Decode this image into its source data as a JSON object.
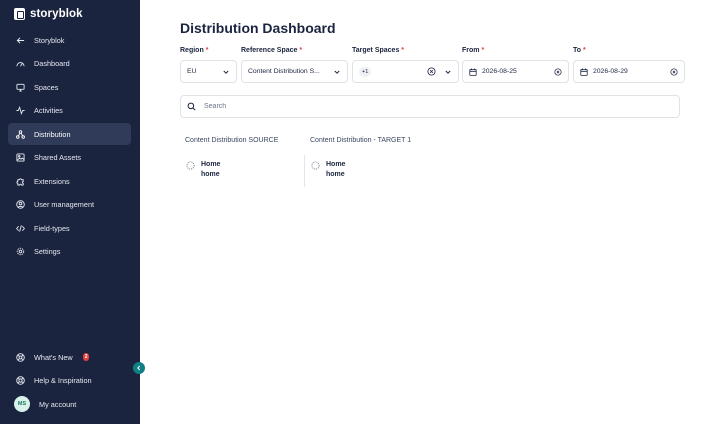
{
  "sidebar": {
    "brand": "storyblok",
    "items": [
      {
        "label": "Storyblok",
        "icon": "arrow-left-icon"
      },
      {
        "label": "Dashboard",
        "icon": "gauge-icon"
      },
      {
        "label": "Spaces",
        "icon": "monitor-icon"
      },
      {
        "label": "Activities",
        "icon": "activity-icon"
      },
      {
        "label": "Distribution",
        "icon": "distribution-icon",
        "active": true
      },
      {
        "label": "Shared Assets",
        "icon": "image-icon"
      },
      {
        "label": "Extensions",
        "icon": "puzzle-icon"
      },
      {
        "label": "User management",
        "icon": "user-circle-icon"
      },
      {
        "label": "Field-types",
        "icon": "code-icon"
      },
      {
        "label": "Settings",
        "icon": "gear-icon"
      }
    ],
    "bottom": {
      "whats_new": "What's New",
      "whats_new_badge": "2",
      "help": "Help & Inspiration",
      "account": "My account",
      "avatar_initials": "MS"
    }
  },
  "page": {
    "title": "Distribution Dashboard",
    "filters": {
      "region": {
        "label": "Region",
        "value": "EU"
      },
      "reference_space": {
        "label": "Reference Space",
        "value": "Content Distribution S..."
      },
      "target_spaces": {
        "label": "Target Spaces",
        "chip": "+1"
      },
      "from": {
        "label": "From",
        "value": "2026-08-25"
      },
      "to": {
        "label": "To",
        "value": "2026-08-29"
      },
      "required_marker": "*"
    },
    "search_placeholder": "Search",
    "columns": [
      {
        "title": "Content Distribution SOURCE",
        "item_name": "Home",
        "item_slug": "home"
      },
      {
        "title": "Content Distribution - TARGET 1",
        "item_name": "Home",
        "item_slug": "home"
      }
    ]
  },
  "colors": {
    "sidebar_bg": "#1b243f",
    "active_bg": "#2f3b58",
    "accent_teal": "#0f7f86",
    "required_red": "#e53e3e"
  }
}
